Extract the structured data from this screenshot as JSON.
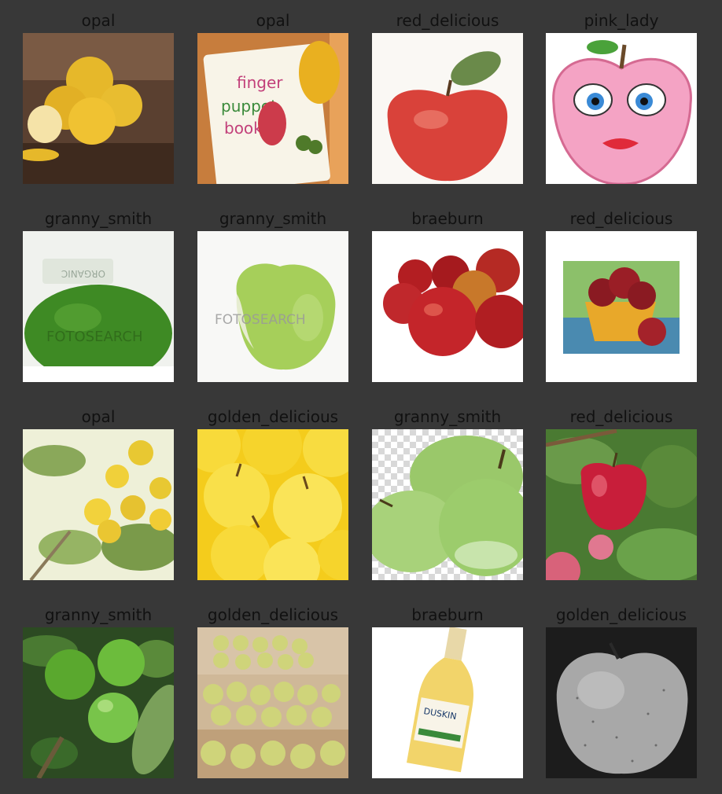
{
  "labels": [
    "opal",
    "opal",
    "red_delicious",
    "pink_lady",
    "granny_smith",
    "granny_smith",
    "braeburn",
    "red_delicious",
    "opal",
    "golden_delicious",
    "granny_smith",
    "red_delicious",
    "granny_smith",
    "golden_delicious",
    "braeburn",
    "golden_delicious"
  ],
  "image_text": {
    "book_line1": "finger",
    "book_line2": "puppet",
    "book_line3": "book",
    "watermark": "FOTOSEARCH",
    "watermark_tag": "ORGANIC",
    "bottle_brand": "DUSKIN"
  },
  "colors": {
    "background": "#383838",
    "label_text": "#111111"
  }
}
